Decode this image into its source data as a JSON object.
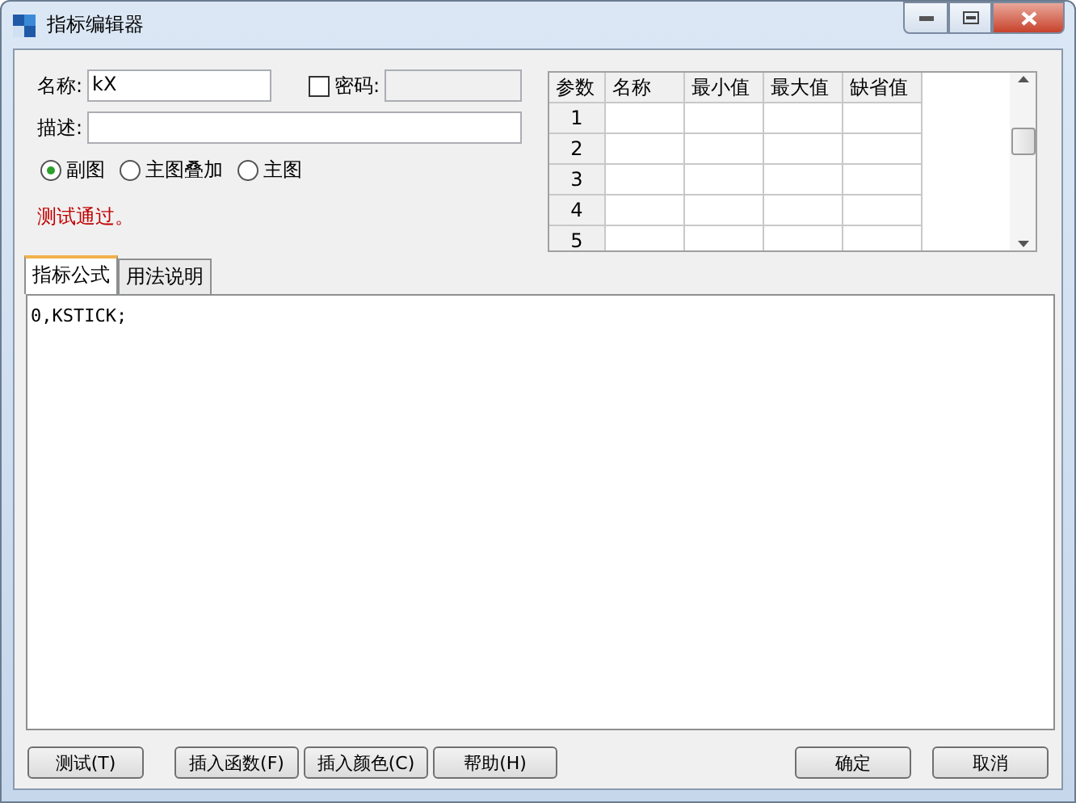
{
  "window": {
    "title": "指标编辑器"
  },
  "form": {
    "name_label": "名称:",
    "name_value": "kX",
    "password_checked": false,
    "password_label": "密码:",
    "description_label": "描述:"
  },
  "chart_types": [
    {
      "label": "副图",
      "selected": true
    },
    {
      "label": "主图叠加",
      "selected": false
    },
    {
      "label": "主图",
      "selected": false
    }
  ],
  "status_message": "测试通过。",
  "params_table": {
    "columns": [
      "参数",
      "名称",
      "最小值",
      "最大值",
      "缺省值"
    ],
    "rows": [
      "1",
      "2",
      "3",
      "4",
      "5"
    ]
  },
  "tabs": [
    {
      "label": "指标公式",
      "selected": true
    },
    {
      "label": "用法说明",
      "selected": false
    }
  ],
  "formula": "0,KSTICK;",
  "buttons_left": [
    "测试(T)",
    "插入函数(F)",
    "插入颜色(C)",
    "帮助(H)"
  ],
  "buttons_right": [
    "确定",
    "取消"
  ]
}
